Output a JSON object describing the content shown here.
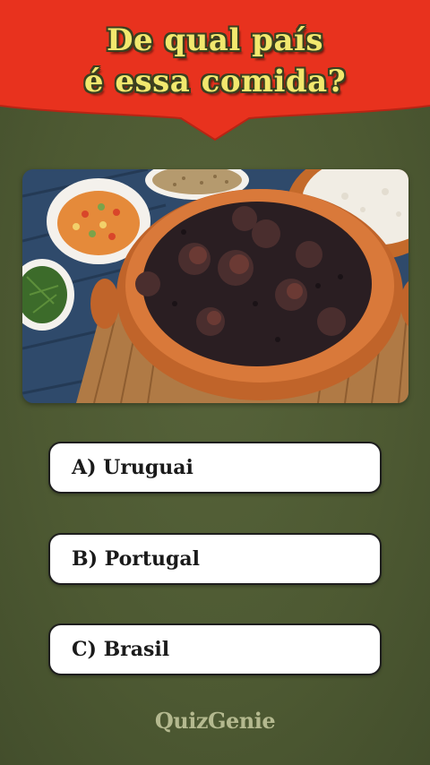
{
  "header": {
    "title_line1": "De qual país",
    "title_line2": "é essa comida?"
  },
  "image": {
    "subject": "feijoada"
  },
  "options": [
    {
      "label": "A) Uruguai"
    },
    {
      "label": "B) Portugal"
    },
    {
      "label": "C) Brasil"
    }
  ],
  "brand": "QuizGenie",
  "colors": {
    "banner_red": "#e8321e",
    "title_yellow": "#f2e86e",
    "background_green": "#4f5b34",
    "option_bg": "#ffffff",
    "brand_text": "#b4b98f"
  }
}
